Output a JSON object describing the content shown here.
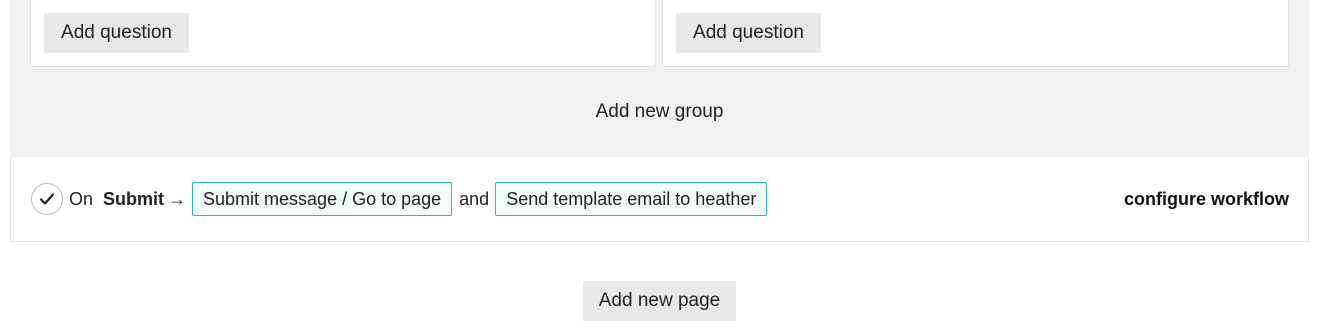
{
  "groups": [
    {
      "add_question_label": "Add question"
    },
    {
      "add_question_label": "Add question"
    }
  ],
  "add_group_label": "Add new group",
  "workflow": {
    "on_label": "On",
    "trigger": "Submit",
    "arrow": "→",
    "actions": [
      "Submit message / Go to page",
      "Send template email to heather"
    ],
    "and_label": "and",
    "configure_label": "configure workflow",
    "accent_color": "#29b7b7"
  },
  "add_page_label": "Add new page"
}
